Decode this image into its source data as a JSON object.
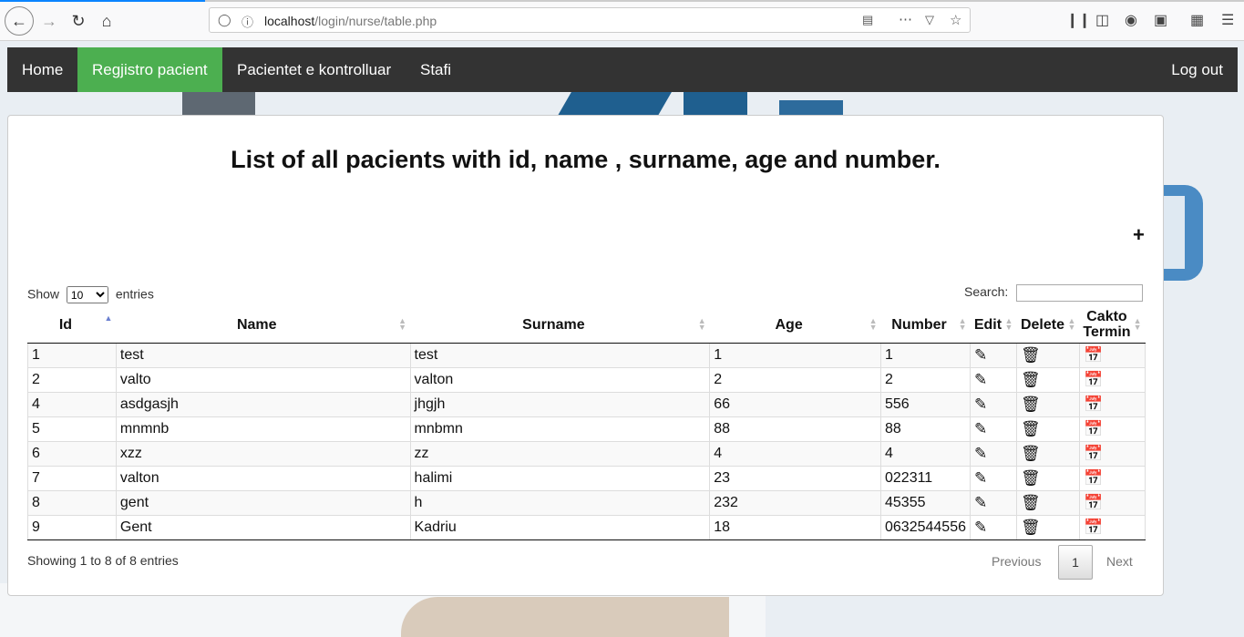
{
  "browser": {
    "url_host": "localhost",
    "url_path": "/login/nurse/table.php"
  },
  "nav": {
    "items": [
      "Home",
      "Regjistro pacient",
      "Pacientet e kontrolluar",
      "Stafi"
    ],
    "logout": "Log out"
  },
  "page": {
    "title": "List of all pacients with id, name , surname, age and number.",
    "add_symbol": "+"
  },
  "table": {
    "show_label": "Show",
    "entries_label": "entries",
    "page_length": "10",
    "search_label": "Search:",
    "columns": [
      "Id",
      "Name",
      "Surname",
      "Age",
      "Number",
      "Edit",
      "Delete",
      "Cakto Termin"
    ],
    "rows": [
      [
        "1",
        "test",
        "test",
        "1",
        "1"
      ],
      [
        "2",
        "valto",
        "valton",
        "2",
        "2"
      ],
      [
        "4",
        "asdgasjh",
        "jhgjh",
        "66",
        "556"
      ],
      [
        "5",
        "mnmnb",
        "mnbmn",
        "88",
        "88"
      ],
      [
        "6",
        "xzz",
        "zz",
        "4",
        "4"
      ],
      [
        "7",
        "valton",
        "halimi",
        "23",
        "022311"
      ],
      [
        "8",
        "gent",
        "h",
        "232",
        "45355"
      ],
      [
        "9",
        "Gent",
        "Kadriu",
        "18",
        "0632544556"
      ]
    ],
    "info": "Showing 1 to 8 of 8 entries",
    "prev": "Previous",
    "current_page": "1",
    "next": "Next"
  },
  "colors": {
    "nav_bg": "#333333",
    "active_nav": "#4caf50"
  }
}
